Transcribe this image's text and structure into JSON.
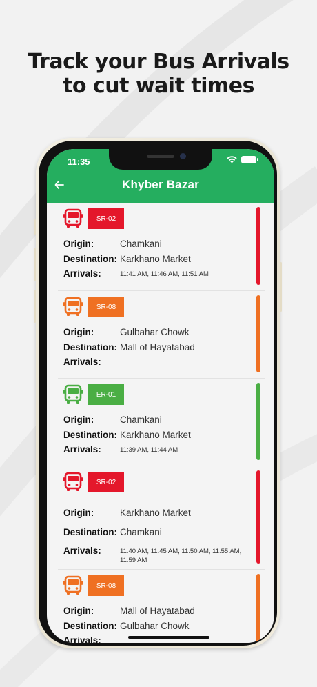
{
  "headline": {
    "line1": "Track your Bus Arrivals",
    "line2": "to cut wait times"
  },
  "status_bar": {
    "time": "11:35"
  },
  "app_bar": {
    "title": "Khyber Bazar",
    "back_icon": "arrow-left-icon"
  },
  "labels": {
    "origin": "Origin:",
    "destination": "Destination:",
    "arrivals": "Arrivals:"
  },
  "colors": {
    "red": "#e4172b",
    "orange": "#ef7022",
    "green": "#4aae44",
    "header": "#25ae5f"
  },
  "routes": [
    {
      "code": "SR-02",
      "color": "red",
      "origin": "Chamkani",
      "destination": "Karkhano Market",
      "arrivals": "11:41 AM, 11:46 AM, 11:51 AM"
    },
    {
      "code": "SR-08",
      "color": "orange",
      "origin": "Gulbahar Chowk",
      "destination": "Mall of Hayatabad",
      "arrivals": ""
    },
    {
      "code": "ER-01",
      "color": "green",
      "origin": "Chamkani",
      "destination": "Karkhano Market",
      "arrivals": "11:39 AM, 11:44 AM"
    },
    {
      "code": "SR-02",
      "color": "red",
      "origin": "Karkhano Market",
      "destination": "Chamkani",
      "arrivals": "11:40 AM, 11:45 AM, 11:50 AM, 11:55 AM, 11:59 AM"
    },
    {
      "code": "SR-08",
      "color": "orange",
      "origin": "Mall of Hayatabad",
      "destination": "Gulbahar Chowk",
      "arrivals": ""
    }
  ]
}
